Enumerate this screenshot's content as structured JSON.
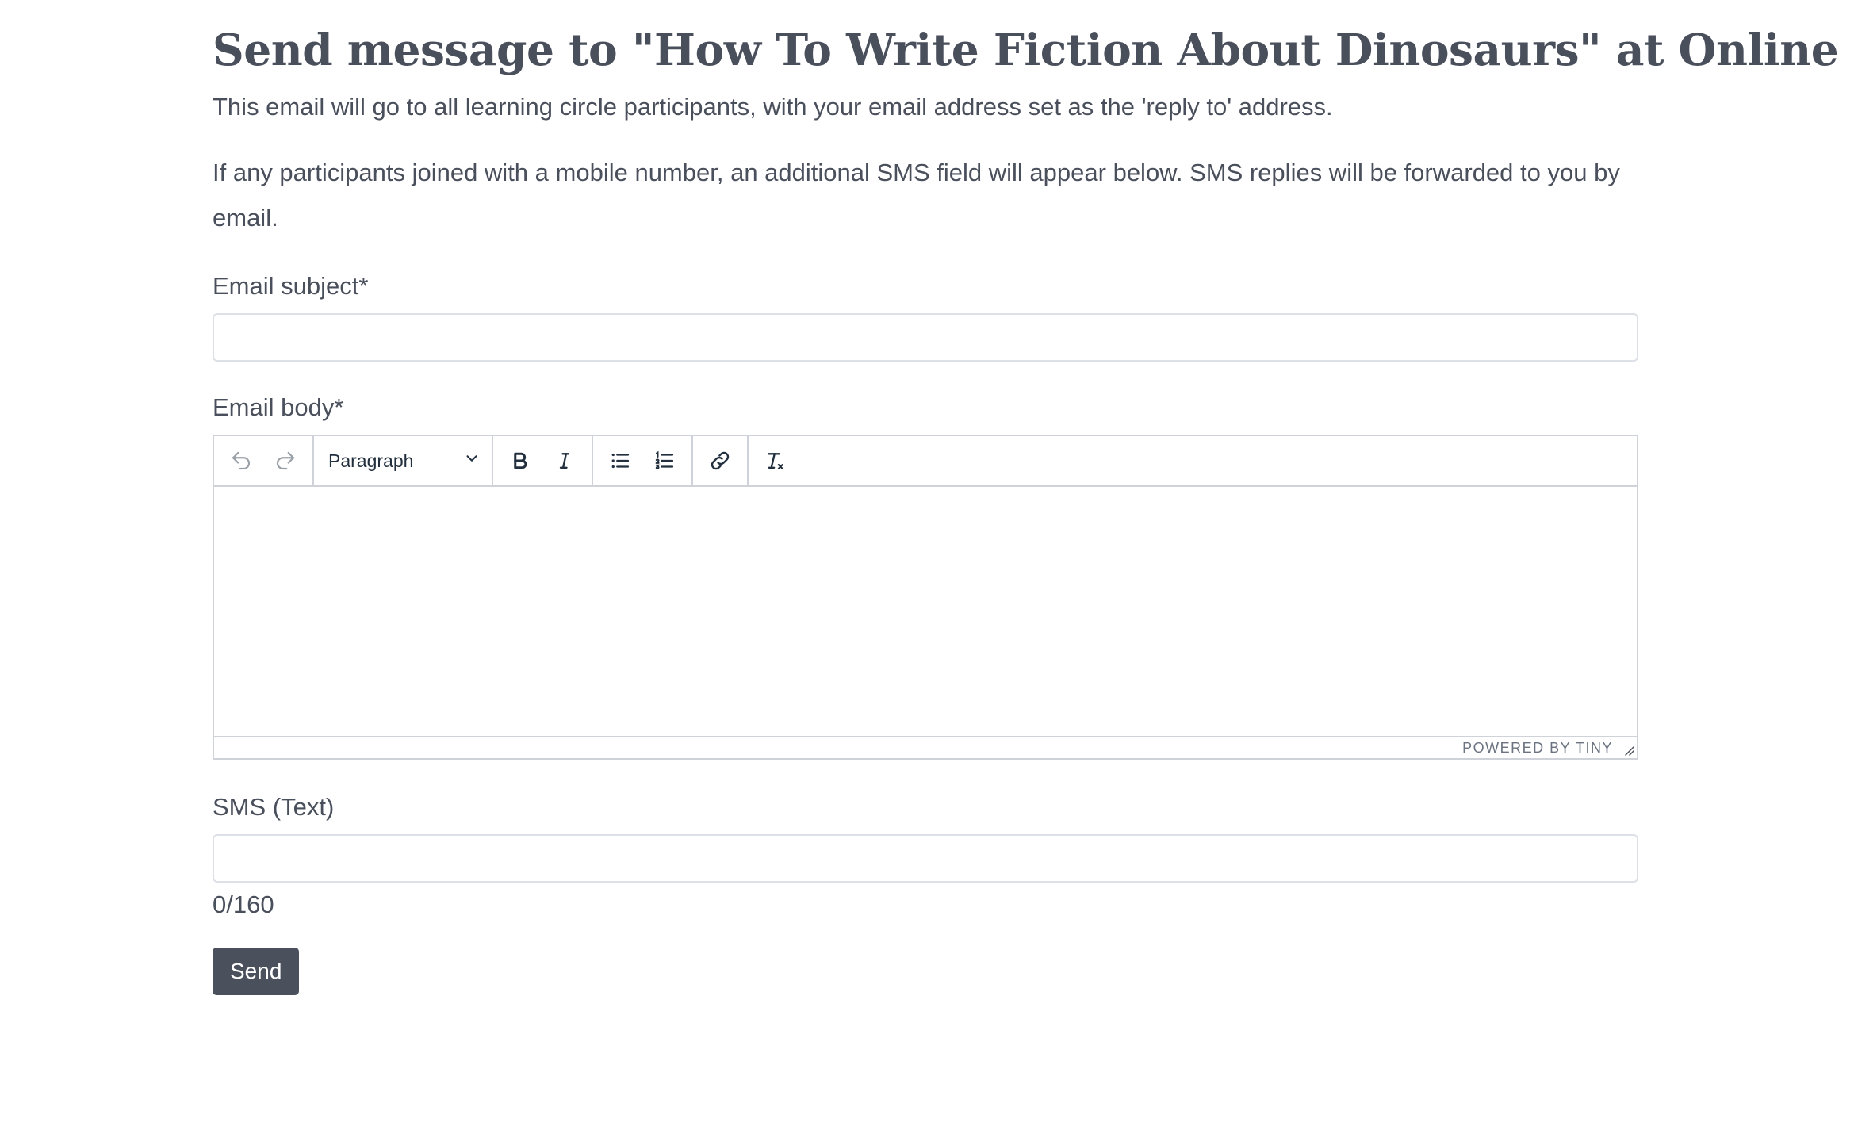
{
  "page": {
    "title": "Send message to \"How To Write Fiction About Dinosaurs\" at Online",
    "intro_1": "This email will go to all learning circle participants, with your email address set as the 'reply to' address.",
    "intro_2": "If any participants joined with a mobile number, an additional SMS field will appear below. SMS replies will be forwarded to you by email."
  },
  "form": {
    "subject_label": "Email subject*",
    "subject_value": "",
    "body_label": "Email body*",
    "sms_label": "SMS (Text)",
    "sms_value": "",
    "sms_count": "0/160",
    "send_label": "Send"
  },
  "editor": {
    "block_format": "Paragraph",
    "branding": "POWERED BY TINY",
    "toolbar_icons": [
      "undo-icon",
      "redo-icon",
      "chevron-down-icon",
      "bold-icon",
      "italic-icon",
      "bullet-list-icon",
      "numbered-list-icon",
      "link-icon",
      "remove-format-icon",
      "resize-icon"
    ]
  },
  "colors": {
    "text": "#4a4f5c",
    "button_bg": "#4b505d",
    "border": "#dde0e6"
  }
}
